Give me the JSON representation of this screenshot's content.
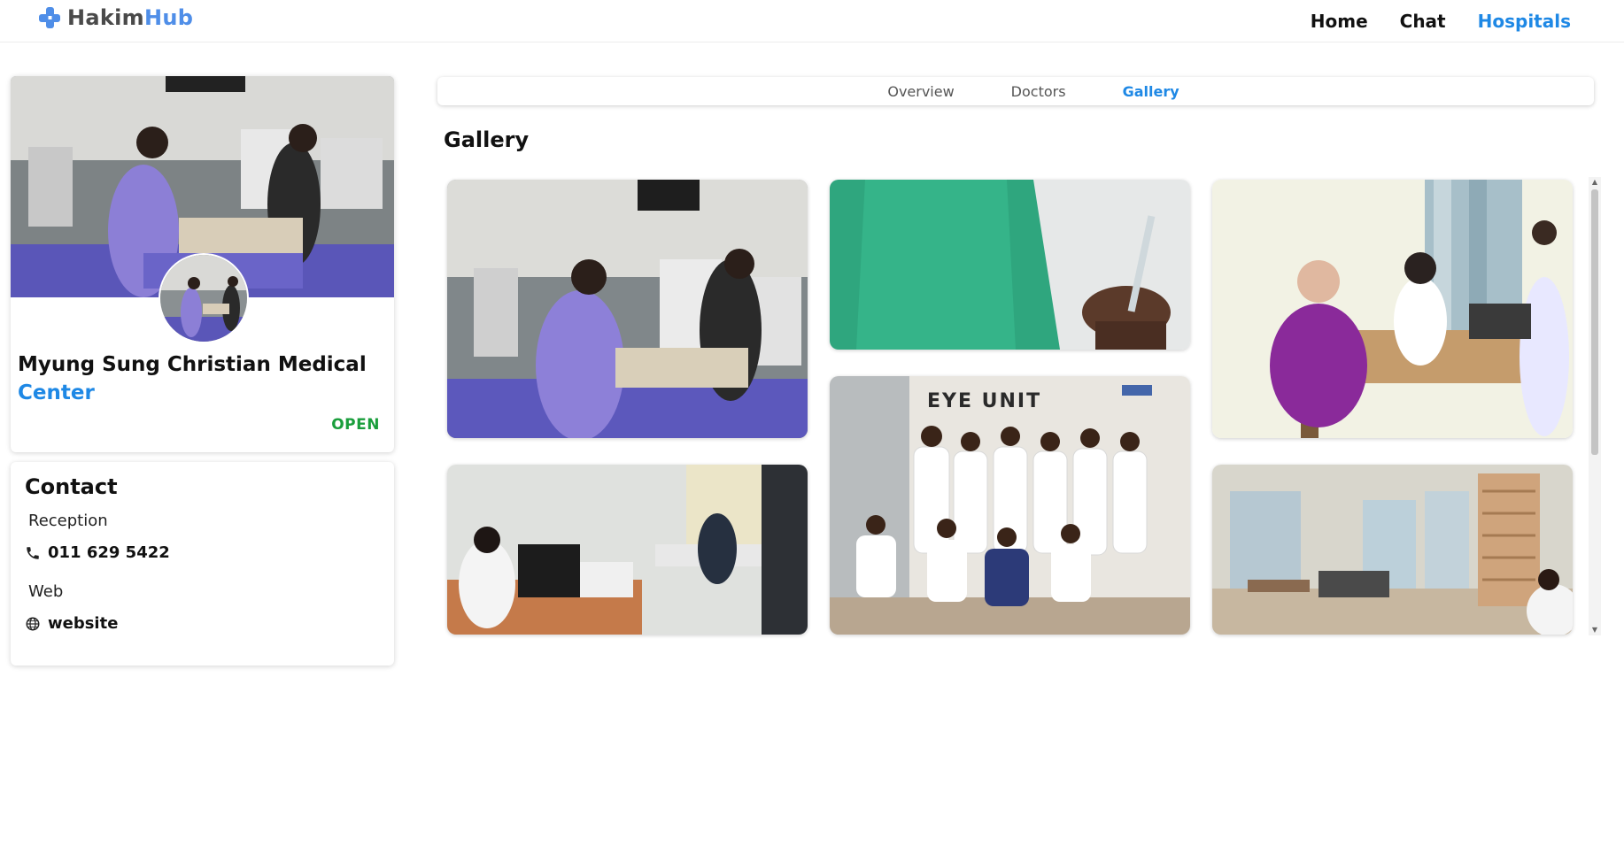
{
  "app": {
    "logo_part1": "Hakim",
    "logo_part2": "Hub",
    "accent": "#1e88e5"
  },
  "nav": {
    "items": [
      {
        "label": "Home",
        "active": false
      },
      {
        "label": "Chat",
        "active": false
      },
      {
        "label": "Hospitals",
        "active": true
      }
    ]
  },
  "hospital": {
    "name_line1": "Myung Sung Christian Medical",
    "name_line2": "Center",
    "status": "OPEN",
    "status_color": "#1a9e3c"
  },
  "contact": {
    "title": "Contact",
    "reception_label": "Reception",
    "phone": "011 629 5422",
    "phone_icon": "phone-icon",
    "web_label": "Web",
    "website": "website",
    "web_icon": "globe-icon"
  },
  "tabs": {
    "items": [
      {
        "label": "Overview",
        "active": false
      },
      {
        "label": "Doctors",
        "active": false
      },
      {
        "label": "Gallery",
        "active": true
      }
    ]
  },
  "gallery": {
    "title": "Gallery",
    "images": [
      {
        "name": "gallery-image-dialysis-ward"
      },
      {
        "name": "gallery-image-syringe"
      },
      {
        "name": "gallery-image-consultation"
      },
      {
        "name": "gallery-image-computer-office"
      },
      {
        "name": "gallery-image-eye-unit-team",
        "caption": "EYE UNIT"
      },
      {
        "name": "gallery-image-physiotherapy-room"
      }
    ]
  }
}
